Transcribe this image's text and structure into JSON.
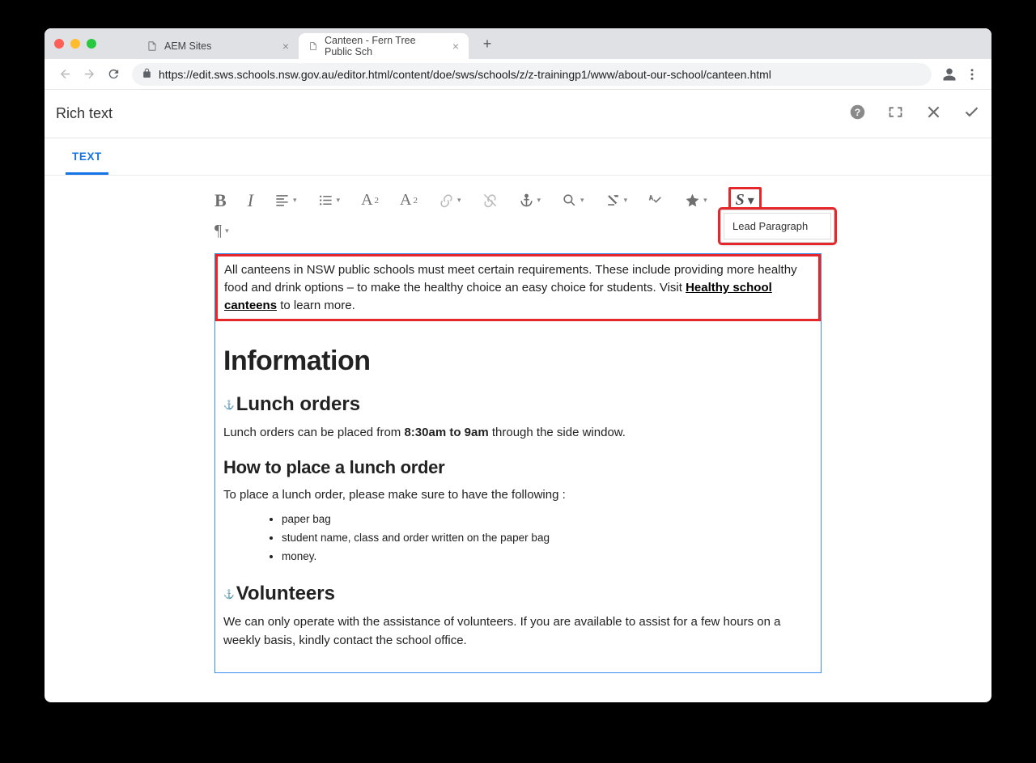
{
  "browser": {
    "tabs": [
      {
        "title": "AEM Sites",
        "active": false
      },
      {
        "title": "Canteen - Fern Tree Public Sch",
        "active": true
      }
    ],
    "url": "https://edit.sws.schools.nsw.gov.au/editor.html/content/doe/sws/schools/z/z-trainingp1/www/about-our-school/canteen.html"
  },
  "aem": {
    "title": "Rich text",
    "tab_label": "TEXT"
  },
  "toolbar": {
    "styles_dropdown_item": "Lead Paragraph"
  },
  "content": {
    "lead_before": "All canteens in NSW public schools must meet certain requirements. These include providing more healthy food and drink options – to make the healthy choice an easy choice for students. Visit ",
    "lead_link": "Healthy school canteens",
    "lead_after": " to learn more.",
    "h1": "Information",
    "h2_lunch": "Lunch orders",
    "p_lunch_a": "Lunch orders can be placed from ",
    "p_lunch_b_bold": "8:30am to 9am",
    "p_lunch_c": " through the side window.",
    "h3_howto": "How to place a lunch order",
    "p_howto": "To place a lunch order, please make sure to have the following :",
    "list": {
      "0": "paper bag",
      "1": "student name, class and order written on the paper bag",
      "2": "money."
    },
    "h2_vol": "Volunteers",
    "p_vol": "We can only operate with the assistance of volunteers. If you are available to assist for a few hours on a weekly basis, kindly contact the school office."
  }
}
